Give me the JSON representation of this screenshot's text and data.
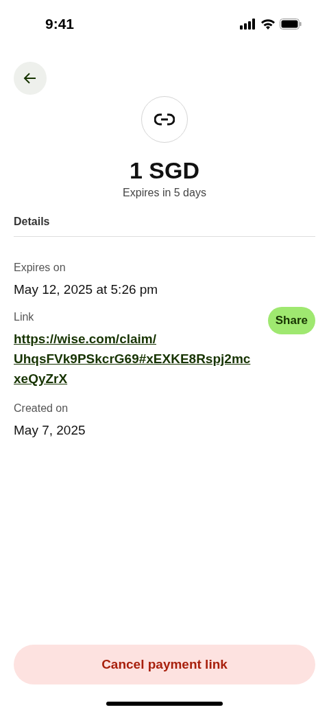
{
  "status_bar": {
    "time": "9:41"
  },
  "amount": "1 SGD",
  "subtitle": "Expires in 5 days",
  "section_title": "Details",
  "details": [
    {
      "kind": "text",
      "label": "Expires on",
      "value": "May 12, 2025 at 5:26 pm"
    },
    {
      "kind": "link",
      "label": "Link",
      "lines": [
        "https://wise.com/claim/",
        "UhqsFVk9PSkcrG69#xEXKE8Rspj2mc",
        "xeQyZrX"
      ],
      "action": "Share"
    },
    {
      "kind": "text",
      "label": "Created on",
      "value": "May 7, 2025"
    }
  ],
  "cancel_button": "Cancel payment link"
}
